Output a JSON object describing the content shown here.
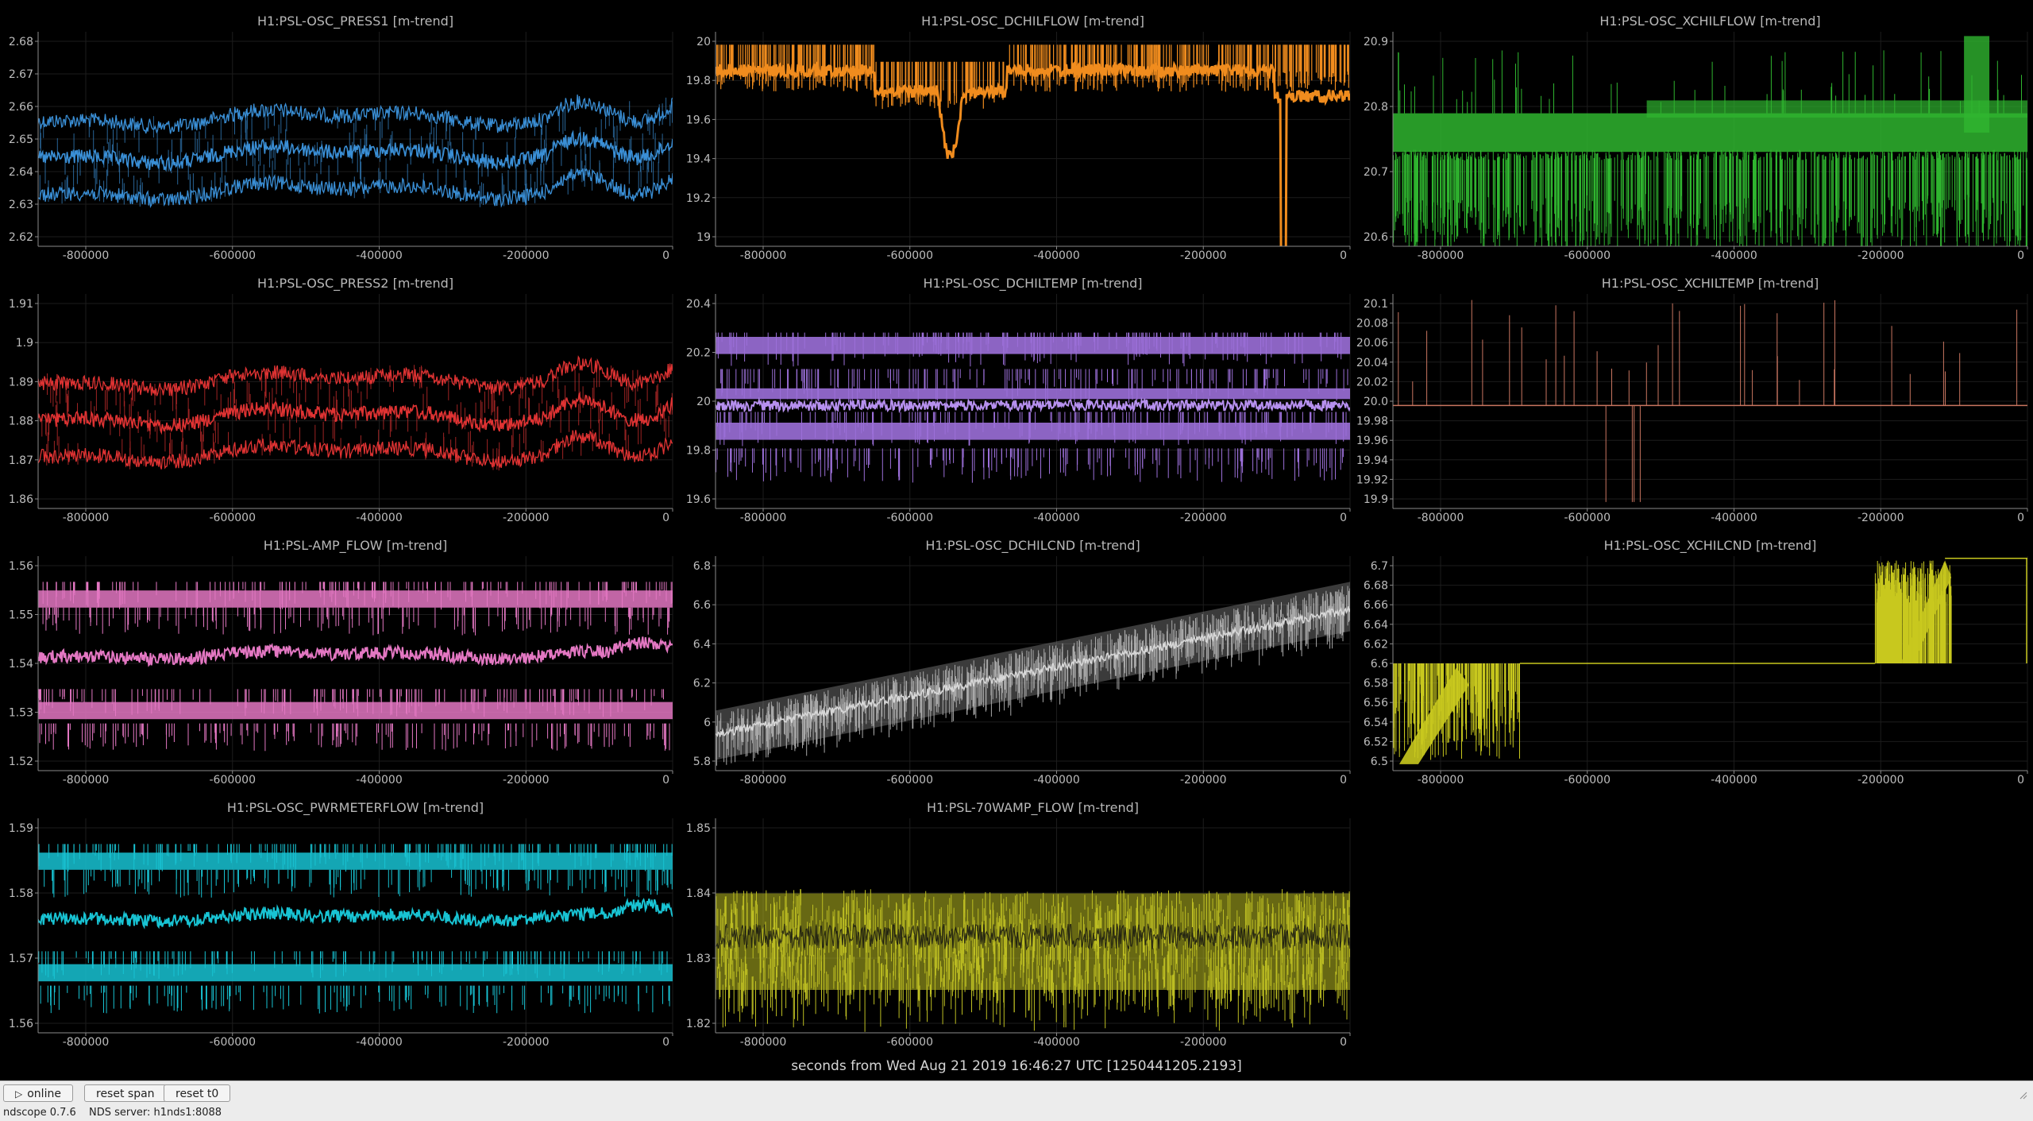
{
  "plots": [
    {
      "title": "H1:PSL-OSC_PRESS1 [m-trend]",
      "color": "#3a8fd6",
      "style": "band-wave",
      "yticks": [
        "2.68",
        "2.67",
        "2.66",
        "2.65",
        "2.64",
        "2.63",
        "2.62"
      ],
      "xticks": [
        "-800000",
        "-600000",
        "-400000",
        "-200000",
        "0"
      ]
    },
    {
      "title": "H1:PSL-OSC_DCHILFLOW [m-trend]",
      "color": "#f08c1e",
      "style": "dchilflow",
      "yticks": [
        "20",
        "19.8",
        "19.6",
        "19.4",
        "19.2",
        "19"
      ],
      "xticks": [
        "-800000",
        "-600000",
        "-400000",
        "-200000",
        "0"
      ]
    },
    {
      "title": "H1:PSL-OSC_XCHILFLOW [m-trend]",
      "color": "#2fb52f",
      "style": "xchilflow",
      "yticks": [
        "20.9",
        "20.8",
        "20.7",
        "20.6"
      ],
      "xticks": [
        "-800000",
        "-600000",
        "-400000",
        "-200000",
        "0"
      ]
    },
    {
      "title": "H1:PSL-OSC_PRESS2 [m-trend]",
      "color": "#e03333",
      "style": "band-wave",
      "yticks": [
        "1.91",
        "1.9",
        "1.89",
        "1.88",
        "1.87",
        "1.86"
      ],
      "xticks": [
        "-800000",
        "-600000",
        "-400000",
        "-200000",
        "0"
      ]
    },
    {
      "title": "H1:PSL-OSC_DCHILTEMP [m-trend]",
      "color": "#9b6fd8",
      "style": "digital-band",
      "yticks": [
        "20.4",
        "20.2",
        "20",
        "19.8",
        "19.6"
      ],
      "xticks": [
        "-800000",
        "-600000",
        "-400000",
        "-200000",
        "0"
      ]
    },
    {
      "title": "H1:PSL-OSC_XCHILTEMP [m-trend]",
      "color": "#c87560",
      "style": "spikes",
      "yticks": [
        "20.1",
        "20.08",
        "20.06",
        "20.04",
        "20.02",
        "20.0",
        "19.98",
        "19.96",
        "19.94",
        "19.92",
        "19.9"
      ],
      "xticks": [
        "-800000",
        "-600000",
        "-400000",
        "-200000",
        "0"
      ]
    },
    {
      "title": "H1:PSL-AMP_FLOW [m-trend]",
      "color": "#e377c2",
      "style": "digital-wave",
      "yticks": [
        "1.56",
        "1.55",
        "1.54",
        "1.53",
        "1.52"
      ],
      "xticks": [
        "-800000",
        "-600000",
        "-400000",
        "-200000",
        "0"
      ]
    },
    {
      "title": "H1:PSL-OSC_DCHILCND [m-trend]",
      "color": "#a8a8a8",
      "style": "diagonal",
      "yticks": [
        "6.8",
        "6.6",
        "6.4",
        "6.2",
        "6",
        "5.8"
      ],
      "xticks": [
        "-800000",
        "-600000",
        "-400000",
        "-200000",
        "0"
      ]
    },
    {
      "title": "H1:PSL-OSC_XCHILCND [m-trend]",
      "color": "#c8c81e",
      "style": "xchilcnd",
      "yticks": [
        "6.7",
        "6.68",
        "6.66",
        "6.64",
        "6.62",
        "6.6",
        "6.58",
        "6.56",
        "6.54",
        "6.52",
        "6.5"
      ],
      "xticks": [
        "-800000",
        "-600000",
        "-400000",
        "-200000",
        "0"
      ]
    },
    {
      "title": "H1:PSL-OSC_PWRMETERFLOW [m-trend]",
      "color": "#18c3d3",
      "style": "digital-wave",
      "yticks": [
        "1.59",
        "1.58",
        "1.57",
        "1.56"
      ],
      "xticks": [
        "-800000",
        "-600000",
        "-400000",
        "-200000",
        "0"
      ]
    },
    {
      "title": "H1:PSL-70WAMP_FLOW [m-trend]",
      "color": "#bcbd22",
      "style": "noisy-band",
      "yticks": [
        "1.85",
        "1.84",
        "1.83",
        "1.82"
      ],
      "xticks": [
        "-800000",
        "-600000",
        "-400000",
        "-200000",
        "0"
      ]
    }
  ],
  "xlabel": "seconds from Wed Aug 21 2019 16:46:27 UTC [1250441205.2193]",
  "toolbar": {
    "online_label": "online",
    "online_icon": "play-icon",
    "reset_span_label": "reset span",
    "reset_t0_label": "reset t0"
  },
  "status": {
    "version": "ndscope 0.7.6",
    "server": "NDS server: h1nds1:8088"
  }
}
